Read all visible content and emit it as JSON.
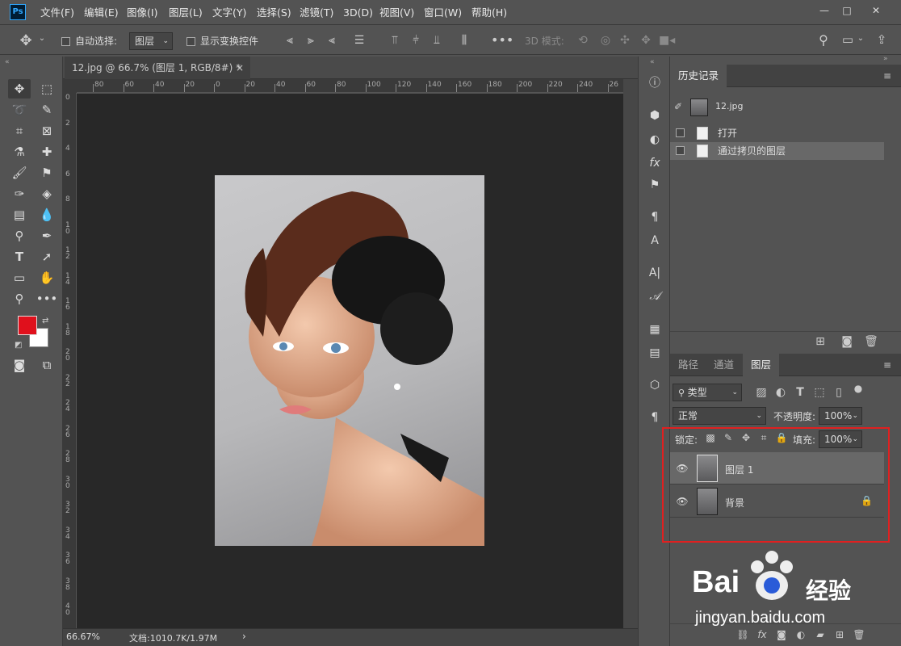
{
  "app": {
    "logo": "Ps"
  },
  "menu": [
    "文件(F)",
    "编辑(E)",
    "图像(I)",
    "图层(L)",
    "文字(Y)",
    "选择(S)",
    "滤镜(T)",
    "3D(D)",
    "视图(V)",
    "窗口(W)",
    "帮助(H)"
  ],
  "window_controls": [
    "—",
    "□",
    "✕"
  ],
  "options": {
    "auto_select_label": "自动选择:",
    "auto_select_value": "图层",
    "transform_controls_label": "显示变换控件",
    "mode3d_label": "3D 模式:"
  },
  "document": {
    "tab_title": "12.jpg @ 66.7% (图层 1, RGB/8#) *",
    "close": "×",
    "zoom": "66.67%",
    "doc_info": "文档:1010.7K/1.97M",
    "status_arrow": "›"
  },
  "ruler": {
    "h_ticks": [
      "80",
      "60",
      "40",
      "20",
      "0",
      "20",
      "40",
      "60",
      "80",
      "100",
      "120",
      "140",
      "160",
      "180",
      "200",
      "220",
      "240",
      "26"
    ],
    "v_ticks": [
      "0",
      "2",
      "4",
      "6",
      "8",
      "1 0",
      "1 2",
      "1 4",
      "1 6",
      "1 8",
      "2 0",
      "2 2",
      "2 4",
      "2 6",
      "2 8",
      "3 0",
      "3 2",
      "3 4",
      "3 6",
      "3 8",
      "4 0"
    ]
  },
  "colors": {
    "foreground": "#e0101c",
    "background": "#ffffff",
    "highlight_box": "#e02020"
  },
  "history": {
    "tab_label": "历史记录",
    "snapshot_name": "12.jpg",
    "items": [
      {
        "label": "打开",
        "selected": false
      },
      {
        "label": "通过拷贝的图层",
        "selected": true
      }
    ]
  },
  "layers_panel": {
    "tabs": [
      "路径",
      "通道",
      "图层"
    ],
    "active_tab": "图层",
    "filter_label": "类型",
    "blend_mode": "正常",
    "opacity_label": "不透明度:",
    "opacity_value": "100%",
    "lock_label": "锁定:",
    "fill_label": "填充:",
    "fill_value": "100%",
    "layers": [
      {
        "name": "图层 1",
        "selected": true,
        "locked": false
      },
      {
        "name": "背景",
        "selected": false,
        "locked": true
      }
    ]
  },
  "watermark": {
    "brand": "Bai",
    "brand2": "经验",
    "url": "jingyan.baidu.com"
  }
}
